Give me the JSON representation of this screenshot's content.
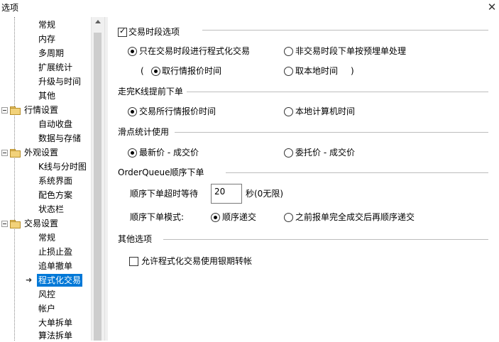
{
  "window": {
    "title": "选项",
    "close": "✕"
  },
  "tree": {
    "items": [
      {
        "label": "常规"
      },
      {
        "label": "内存"
      },
      {
        "label": "多周期"
      },
      {
        "label": "扩展统计"
      },
      {
        "label": "升级与时间"
      },
      {
        "label": "其他"
      },
      {
        "label": "行情设置"
      },
      {
        "label": "自动收盘"
      },
      {
        "label": "数据与存储"
      },
      {
        "label": "外观设置"
      },
      {
        "label": "K线与分时图"
      },
      {
        "label": "系统界面"
      },
      {
        "label": "配色方案"
      },
      {
        "label": "状态栏"
      },
      {
        "label": "交易设置"
      },
      {
        "label": "常规"
      },
      {
        "label": "止损止盈"
      },
      {
        "label": "追单撤单"
      },
      {
        "label": "程式化交易"
      },
      {
        "label": "风控"
      },
      {
        "label": "帐户"
      },
      {
        "label": "大单拆单"
      },
      {
        "label": "算法拆单"
      }
    ]
  },
  "panel": {
    "trading_period": {
      "checkbox_label": "交易时段选项",
      "checked": true,
      "opt_only_in_period": "只在交易时段进行程式化交易",
      "opt_non_period": "非交易时段下单按预埋单处理",
      "paren_open": "(",
      "paren_close": ")",
      "opt_market_time": "取行情报价时间",
      "opt_local_time": "取本地时间"
    },
    "kline_order": {
      "title": "走完K线提前下单",
      "opt_exchange_time": "交易所行情报价时间",
      "opt_local_calc": "本地计算机时间"
    },
    "slippage": {
      "title": "滑点统计使用",
      "opt_latest": "最新价 - 成交价",
      "opt_order": "委托价 - 成交价"
    },
    "order_queue": {
      "title": "OrderQueue顺序下单",
      "timeout_label": "顺序下单超时等待",
      "timeout_value": "20",
      "timeout_unit": "秒(0无限)",
      "mode_label": "顺序下单模式:",
      "opt_sequential": "顺序递交",
      "opt_after_fill": "之前报单完全成交后再顺序递交"
    },
    "other": {
      "title": "其他选项",
      "bank_transfer": "允许程式化交易使用银期转帐",
      "bank_checked": false
    }
  }
}
